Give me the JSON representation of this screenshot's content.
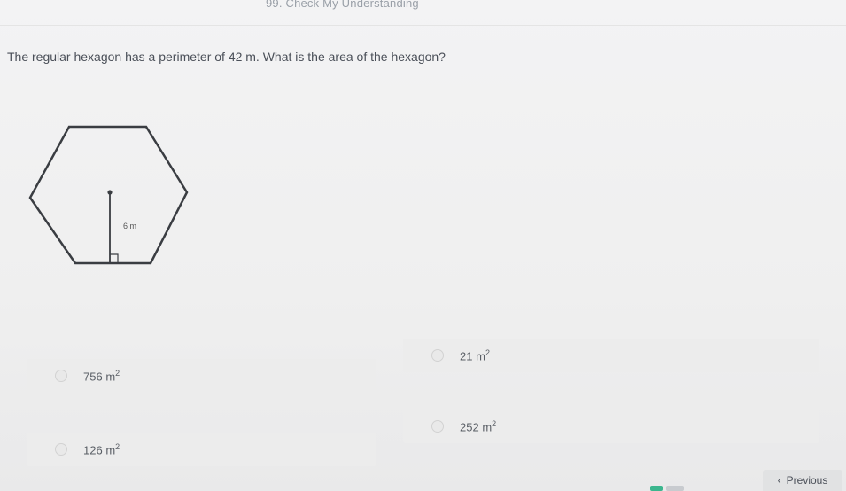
{
  "header": {
    "title": "99. Check My Understanding"
  },
  "question": {
    "text": "The regular hexagon has a perimeter of 42 m. What is the area of the hexagon?"
  },
  "figure": {
    "apothem_label": "6 m"
  },
  "choices": [
    {
      "value": "756",
      "unit": "m",
      "exp": "2"
    },
    {
      "value": "21",
      "unit": "m",
      "exp": "2"
    },
    {
      "value": "126",
      "unit": "m",
      "exp": "2"
    },
    {
      "value": "252",
      "unit": "m",
      "exp": "2"
    }
  ],
  "nav": {
    "previous_label": "Previous",
    "previous_icon": "chevron-left-icon"
  }
}
